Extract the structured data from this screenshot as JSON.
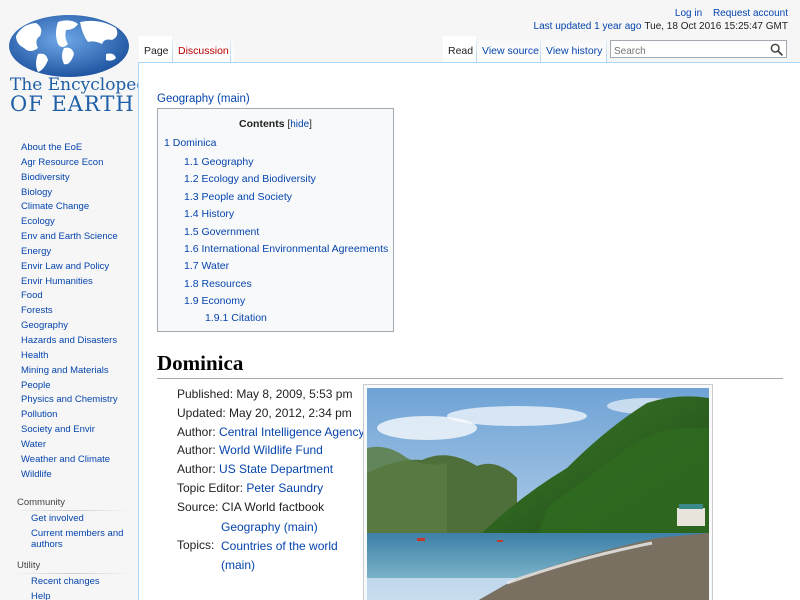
{
  "logo": {
    "line1": "The Encyclopedia",
    "line2": "OF EARTH"
  },
  "sidebar": {
    "nav": [
      "About the EoE",
      "Agr Resource Econ",
      "Biodiversity",
      "Biology",
      "Climate Change",
      "Ecology",
      "Env and Earth Science",
      "Energy",
      "Envir Law and Policy",
      "Envir Humanities",
      "Food",
      "Forests",
      "Geography",
      "Hazards and Disasters",
      "Health",
      "Mining and Materials",
      "People",
      "Physics and Chemistry",
      "Pollution",
      "Society and Envir",
      "Water",
      "Weather and Climate",
      "Wildlife"
    ],
    "community": {
      "heading": "Community",
      "items": [
        "Get involved",
        "Current members and authors"
      ]
    },
    "utility": {
      "heading": "Utility",
      "items": [
        "Recent changes",
        "Help"
      ]
    }
  },
  "personal": {
    "login": "Log in",
    "request": "Request account",
    "updated_link": "Last updated 1 year ago",
    "updated_date": "Tue, 18 Oct 2016 15:25:47 GMT"
  },
  "tabs": {
    "page": "Page",
    "discussion": "Discussion",
    "read": "Read",
    "view_source": "View source",
    "view_history": "View history"
  },
  "search": {
    "placeholder": "Search"
  },
  "content": {
    "category_link": "Geography (main)",
    "toc": {
      "title": "Contents",
      "hide_open": "[",
      "hide": "hide",
      "hide_close": "]",
      "level1": "1 Dominica",
      "level2": [
        "1.1 Geography",
        "1.2 Ecology and Biodiversity",
        "1.3 People and Society",
        "1.4 History",
        "1.5 Government",
        "1.6 International Environmental Agreements",
        "1.7 Water",
        "1.8 Resources",
        "1.9 Economy"
      ],
      "level3": "1.9.1 Citation"
    },
    "heading": "Dominica",
    "meta": {
      "published": "Published: May 8, 2009, 5:53 pm",
      "updated": "Updated: May 20, 2012, 2:34 pm",
      "author_label": "Author: ",
      "authors": [
        "Central Intelligence Agency",
        "World Wildlife Fund",
        "US State Department"
      ],
      "topic_editor_label": "Topic Editor: ",
      "topic_editor": "Peter Saundry",
      "source": "Source: CIA World factbook",
      "topics_label": "Topics:",
      "topics": [
        "Geography (main)",
        "Countries of the world (main)"
      ]
    }
  },
  "colors": {
    "link": "#0645ad",
    "discussion_link": "#ba0000",
    "logo_blue": "#1f5fa8"
  }
}
